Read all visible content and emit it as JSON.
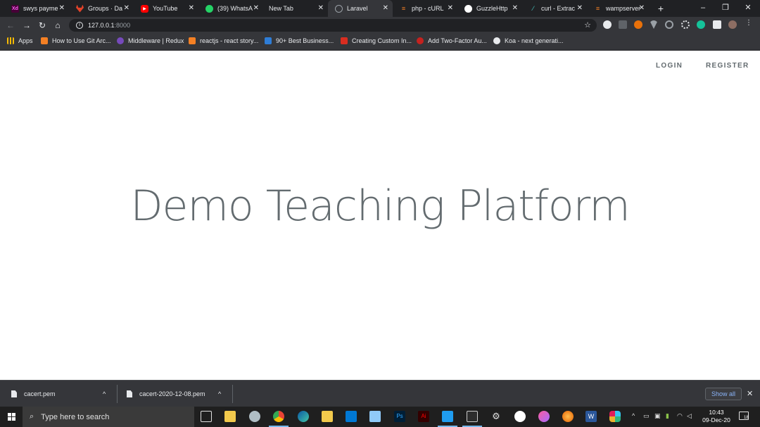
{
  "browser": {
    "tabs": [
      {
        "title": "swys payme",
        "favicon": "xd-icon",
        "color": "#470137"
      },
      {
        "title": "Groups · Da",
        "favicon": "gitlab-icon",
        "color": "#e2432a"
      },
      {
        "title": "YouTube",
        "favicon": "youtube-icon",
        "color": "#ff0000"
      },
      {
        "title": "(39) WhatsA",
        "favicon": "whatsapp-icon",
        "color": "#25d366"
      },
      {
        "title": "New Tab",
        "favicon": "",
        "color": ""
      },
      {
        "title": "Laravel",
        "favicon": "globe-icon",
        "color": "#9aa0a6",
        "active": true
      },
      {
        "title": "php - cURL",
        "favicon": "stackoverflow-icon",
        "color": "#f48024"
      },
      {
        "title": "GuzzleHttp",
        "favicon": "github-icon",
        "color": "#ffffff"
      },
      {
        "title": "curl - Extrac",
        "favicon": "stackexchange-icon",
        "color": "#3ca4a0"
      },
      {
        "title": "wampserver",
        "favicon": "stackoverflow-icon",
        "color": "#f48024"
      }
    ],
    "address": {
      "host": "127.0.0.1",
      "port": ":8000"
    }
  },
  "bookmarks": [
    {
      "label": "Apps",
      "icon": "apps-grid-icon",
      "color": "#fbbc04"
    },
    {
      "label": "How to Use Git Arc...",
      "icon": "stackoverflow-icon",
      "color": "#f48024"
    },
    {
      "label": "Middleware | Redux",
      "icon": "redux-icon",
      "color": "#764abc"
    },
    {
      "label": "reactjs - react story...",
      "icon": "stackoverflow-icon",
      "color": "#f48024"
    },
    {
      "label": "90+ Best Business...",
      "icon": "bookmark-page-icon",
      "color": "#2e7dd7"
    },
    {
      "label": "Creating Custom In...",
      "icon": "bookmark-page-icon",
      "color": "#d92d20"
    },
    {
      "label": "Add Two-Factor Au...",
      "icon": "bookmark-page-icon",
      "color": "#c5221f"
    },
    {
      "label": "Koa - next generati...",
      "icon": "globe-icon",
      "color": "#e8eaed"
    }
  ],
  "page": {
    "login": "LOGIN",
    "register": "REGISTER",
    "title": "Demo Teaching Platform"
  },
  "downloads": {
    "items": [
      "cacert.pem",
      "cacert-2020-12-08.pem"
    ],
    "show_all": "Show all"
  },
  "taskbar": {
    "search_placeholder": "Type here to search",
    "time": "10:43",
    "date": "09-Dec-20",
    "notification_count": "18"
  },
  "colors": {
    "page_text": "#636b6f",
    "browser_bg": "#202124",
    "toolbar_bg": "#35363a"
  }
}
